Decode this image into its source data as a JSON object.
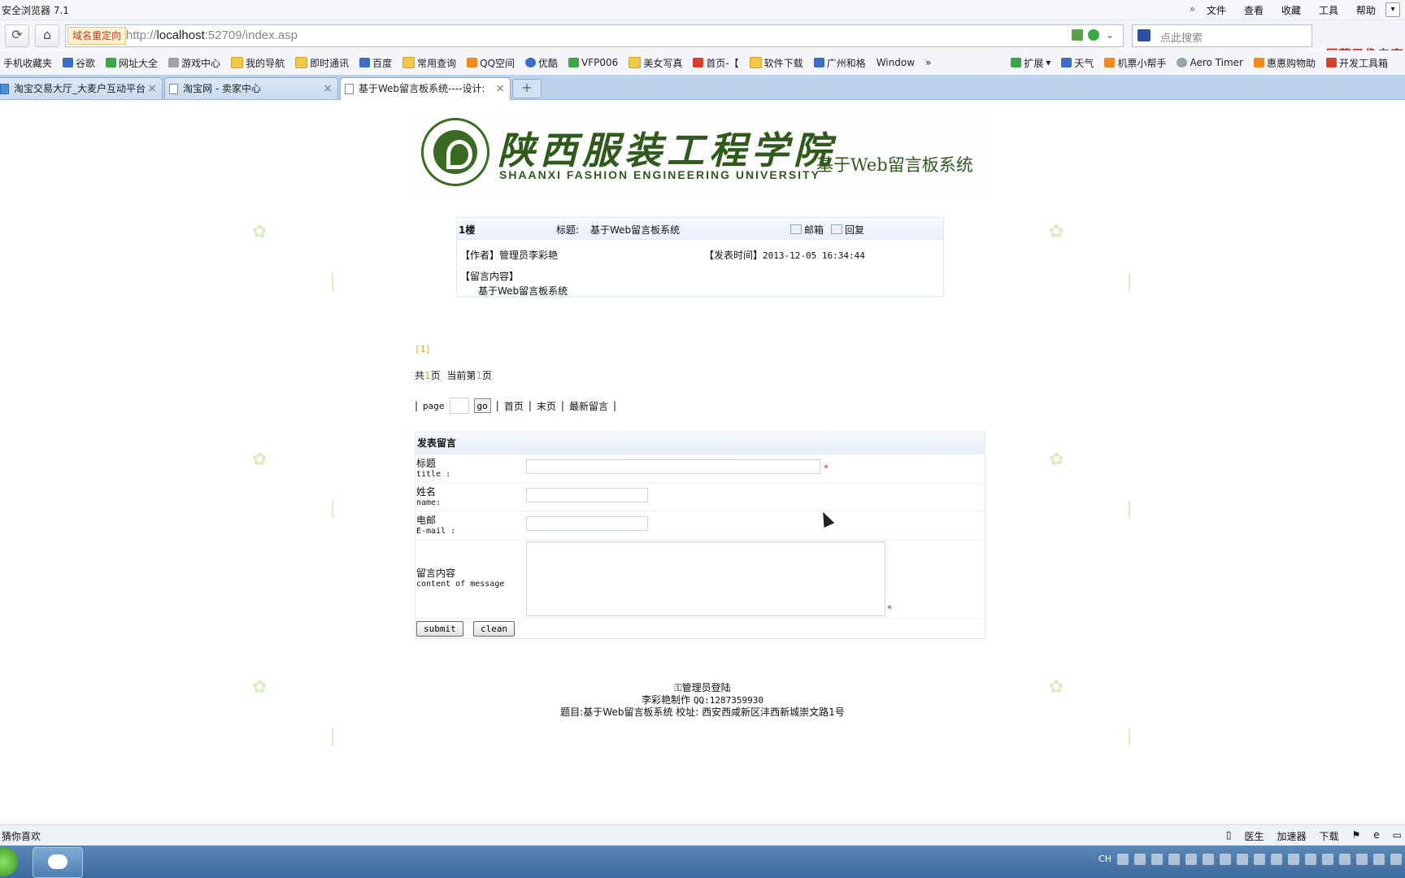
{
  "browser": {
    "app_title": "安全浏览器 7.1",
    "menus": [
      "文件",
      "查看",
      "收藏",
      "工具",
      "帮助"
    ],
    "redirect_label": "域名重定向",
    "url_prefix": "http://",
    "url_host": "localhost",
    "url_rest": ":52709/index.asp",
    "search_placeholder": "点此搜索",
    "recorder_watermark": "屏幕录像专家",
    "bookmarks": [
      "手机收藏夹",
      "谷歌",
      "网址大全",
      "游戏中心",
      "我的导航",
      "即时通讯",
      "百度",
      "常用查询",
      "QQ空间",
      "优酷",
      "VFP006",
      "美女写真",
      "首页-【",
      "软件下载",
      "广州和格",
      "Window"
    ],
    "bookmarks_right": [
      "扩展",
      "天气",
      "机票小帮手",
      "Aero Timer",
      "惠惠购物助",
      "开发工具箱"
    ],
    "tabs": [
      {
        "label": "淘宝交易大厅_大麦户互动平台"
      },
      {
        "label": "淘宝网 - 卖家中心"
      },
      {
        "label": "基于Web留言板系统----设计:"
      }
    ]
  },
  "banner": {
    "school_cn": "陕西服装工程学院",
    "school_en": "SHAANXI FASHION ENGINEERING UNIVERSITY",
    "system_name": "基于Web留言板系统"
  },
  "message": {
    "floor": "1楼",
    "title_label": "标题:",
    "title_value": "基于Web留言板系统",
    "mail_label": "邮箱",
    "reply_label": "回复",
    "author_label": "【作者】",
    "author_value": "管理员李彩艳",
    "time_label": "【发表时间】",
    "time_value": "2013-12-05 16:34:44",
    "content_label": "【留言内容】",
    "content_value": "基于Web留言板系统"
  },
  "pager": {
    "page_link": "[1]",
    "total_prefix": "共",
    "total_pages": "1",
    "total_suffix": "页",
    "current_prefix": "当前第",
    "current_page": "1",
    "current_suffix": "页",
    "page_label": "page",
    "go_label": "go",
    "first_label": "首页",
    "last_label": "末页",
    "latest_label": "最新留言"
  },
  "form": {
    "header": "发表留言",
    "title_cn": "标题",
    "title_en": "title :",
    "name_cn": "姓名",
    "name_en": "name:",
    "email_cn": "电邮",
    "email_en": "E-mail :",
    "content_cn": "留言内容",
    "content_en": "content of message",
    "required_mark": "*",
    "submit_label": "submit",
    "clean_label": "clean"
  },
  "footer": {
    "admin_login": "管理员登陆",
    "maker": "李彩艳制作",
    "qq": "QQ:1287359930",
    "line3": "题目:基于Web留言板系统 校址: 西安西咸新区沣西新城崇文路1号"
  },
  "statusbar": {
    "left": "猜你喜欢",
    "right": [
      "医生",
      "加速器",
      "下载"
    ]
  },
  "tray": {
    "ime": "CH"
  }
}
